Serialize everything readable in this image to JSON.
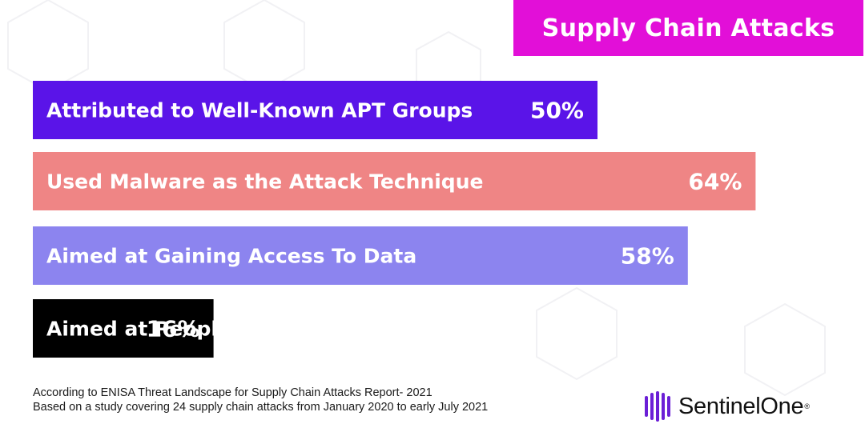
{
  "title": "Supply Chain Attacks",
  "colors": {
    "title_bg": "#e20fd8",
    "bar_colors": [
      "#5a14e8",
      "#ef8585",
      "#8c84ef",
      "#000000"
    ],
    "text": "#ffffff",
    "logo_purple": "#6b1fd6"
  },
  "chart_data": {
    "type": "bar",
    "orientation": "horizontal",
    "title": "Supply Chain Attacks",
    "categories": [
      "Attributed to Well-Known APT Groups",
      "Used Malware as the Attack Technique",
      "Aimed at Gaining Access To Data",
      "Aimed at People"
    ],
    "values": [
      50,
      64,
      58,
      16
    ],
    "value_labels": [
      "50%",
      "64%",
      "58%",
      "16%"
    ],
    "unit": "%",
    "xlim": [
      0,
      70
    ],
    "grid": false,
    "legend": "none"
  },
  "footer": {
    "source_line_1": "According to ENISA Threat Landscape for Supply Chain Attacks Report- 2021",
    "source_line_2": "Based on a study covering 24 supply chain attacks  from January 2020 to early July 2021"
  },
  "logo": {
    "text": "SentinelOne",
    "icon": "sentinelone-logo-icon"
  }
}
